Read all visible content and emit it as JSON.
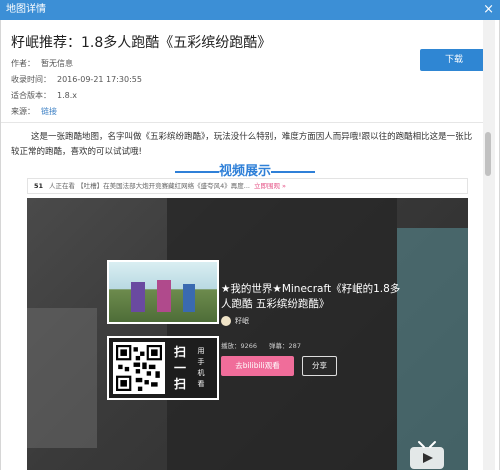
{
  "window": {
    "title": "地图详情",
    "close_glyph": "×"
  },
  "map": {
    "title": "籽岷推荐：1.8多人跑酷《五彩缤纷跑酷》",
    "author_label": "作者：",
    "author_value": "暂无信息",
    "date_label": "收录时间：",
    "date_value": "2016-09-21 17:30:55",
    "version_label": "适合版本：",
    "version_value": "1.8.x",
    "source_label": "来源：",
    "source_value": "链接",
    "download_label": "下载"
  },
  "description": "这是一张跑酷地图，名字叫做《五彩缤纷跑酷》，玩法没什么特别，难度方面因人而异哦!跟以往的跑酷相比这是一张比较正常的跑酷，喜欢的可以试试哦!",
  "video_section": {
    "heading": "视频展示",
    "danmaku_count": "51",
    "danmaku_text": "人正在看 【吐槽】在美国法部大炮开竞赛藏红网络《盛夸风4》再度...",
    "watch_now": "立即围观 »",
    "video_title": "★我的世界★Minecraft《籽岷的1.8多人跑酷 五彩缤纷跑酷》",
    "uploader": "籽岷",
    "plays": "播放：9266",
    "danmaku_stat": "弹幕：287",
    "watch_on_bili": "去bilibili观看",
    "share": "分享",
    "scan_big": "扫一扫",
    "scan_small": "用手机看"
  },
  "colors": {
    "titlebar": "#3c8fd6",
    "accent_blue": "#2f86d3",
    "heading_blue": "#2f80d8",
    "bili_pink": "#f06d9a"
  },
  "icons": {
    "close": "close-icon",
    "tv": "bilibili-tv-icon",
    "qr": "qr-code-icon"
  }
}
